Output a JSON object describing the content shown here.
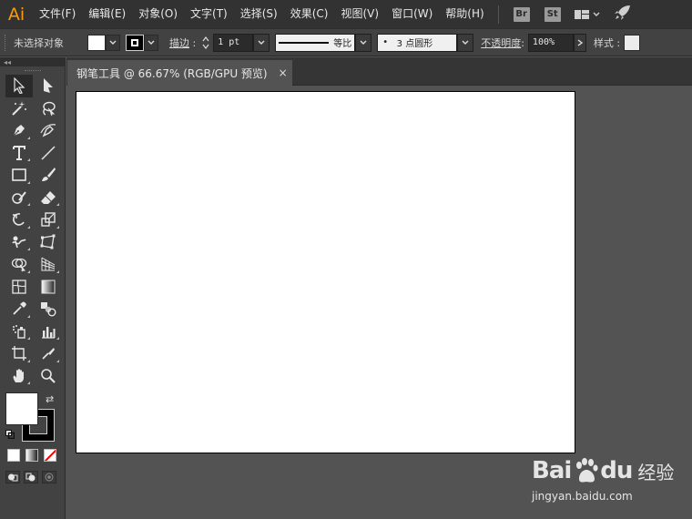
{
  "app": {
    "logo": "Ai",
    "accent": "#ff9a00"
  },
  "menu": {
    "items": [
      "文件(F)",
      "编辑(E)",
      "对象(O)",
      "文字(T)",
      "选择(S)",
      "效果(C)",
      "视图(V)",
      "窗口(W)",
      "帮助(H)"
    ],
    "bridge": "Br",
    "stock": "St"
  },
  "control": {
    "selection_status": "未选择对象",
    "stroke_label": "描边",
    "stroke_weight": "1 pt",
    "profile_label": "等比",
    "brush_label": "3 点圆形",
    "brush_dot": "•",
    "opacity_label": "不透明度",
    "opacity_value": "100%",
    "style_label": "样式"
  },
  "document": {
    "tab_title": "钢笔工具 @ 66.67% (RGB/GPU 预览)",
    "close_glyph": "×",
    "zoom": "66.67%"
  },
  "tools": {
    "collapse_glyph": "◂◂",
    "items": [
      "selection",
      "direct-selection",
      "magic-wand",
      "lasso",
      "pen",
      "curvature",
      "type",
      "line-segment",
      "rectangle",
      "paintbrush",
      "shaper",
      "eraser",
      "rotate",
      "scale",
      "warp",
      "free-transform",
      "shape-builder",
      "perspective-grid",
      "mesh",
      "gradient",
      "eyedropper",
      "blend",
      "symbol-sprayer",
      "column-graph",
      "artboard",
      "slice",
      "hand",
      "zoom"
    ]
  },
  "watermark": {
    "brand_left": "Bai",
    "brand_right": "du",
    "brand_cn": "经验",
    "url": "jingyan.baidu.com"
  }
}
